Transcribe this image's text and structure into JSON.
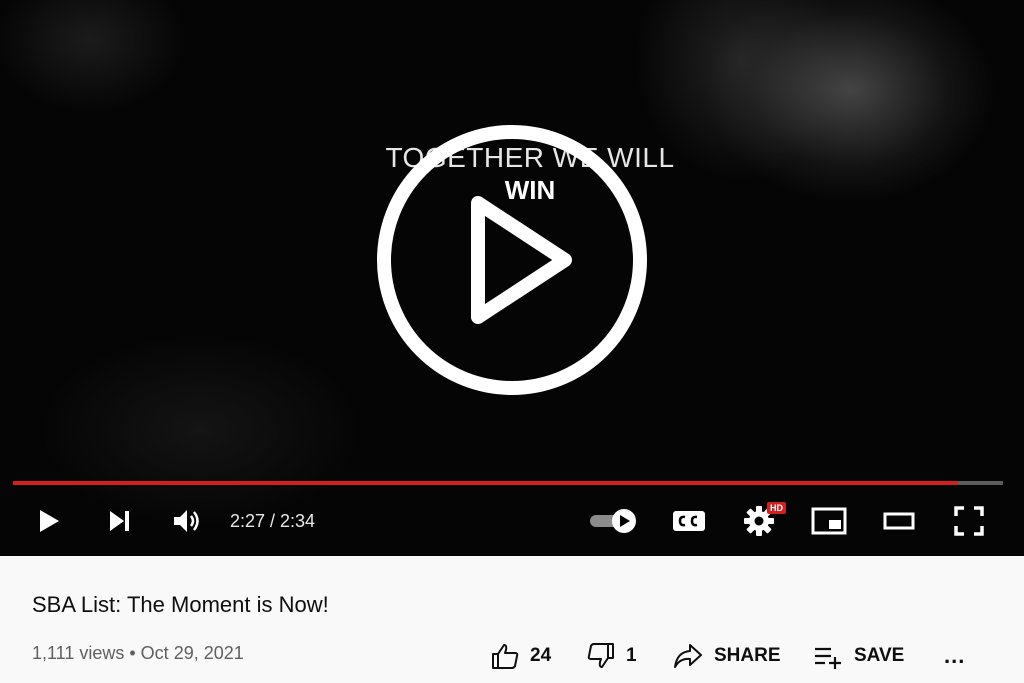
{
  "video": {
    "overlay_line1": "TOGETHER WE WILL",
    "overlay_line2": "WIN",
    "progress_fraction": 0.955,
    "time_display": "2:27 / 2:34",
    "quality_badge": "HD",
    "accent_color": "#d21f1f"
  },
  "controls": {
    "play": "play-icon",
    "next": "next-icon",
    "volume": "volume-icon",
    "autoplay": "autoplay-toggle-icon",
    "captions": "cc-icon",
    "settings": "gear-icon",
    "miniplayer": "miniplayer-icon",
    "theater": "theater-icon",
    "fullscreen": "fullscreen-icon"
  },
  "info": {
    "title": "SBA List: The Moment is Now!",
    "meta": "1,111 views • Oct 29, 2021",
    "likes": "24",
    "dislikes": "1",
    "share_label": "SHARE",
    "save_label": "SAVE",
    "more_label": "..."
  }
}
